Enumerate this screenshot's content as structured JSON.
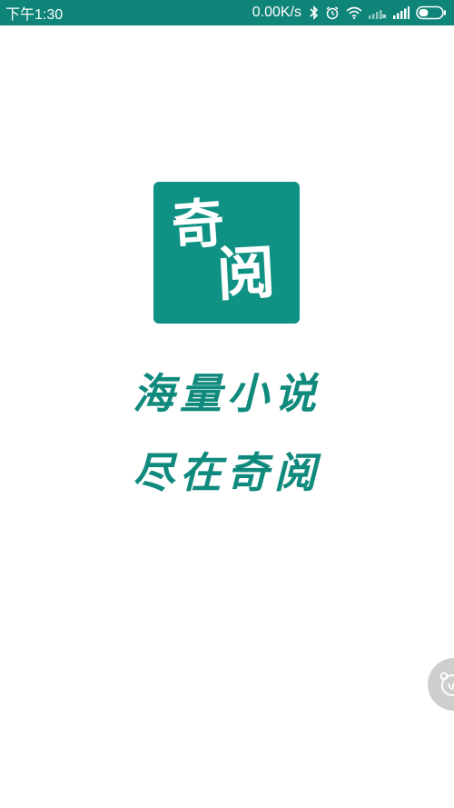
{
  "status_bar": {
    "time": "下午1:30",
    "net_speed": "0.00K/s",
    "icons": [
      "bluetooth-icon",
      "alarm-icon",
      "wifi-icon",
      "signal-weak-icon",
      "signal-icon",
      "battery-icon"
    ],
    "background_color": "#0f8478"
  },
  "logo": {
    "chars": [
      "奇",
      "阅"
    ],
    "background_color": "#0f9283"
  },
  "slogan": {
    "line1": "海量小说",
    "line2": "尽在奇阅",
    "color": "#118a7e"
  },
  "floating_button": {
    "icon": "assist-bear-icon"
  }
}
